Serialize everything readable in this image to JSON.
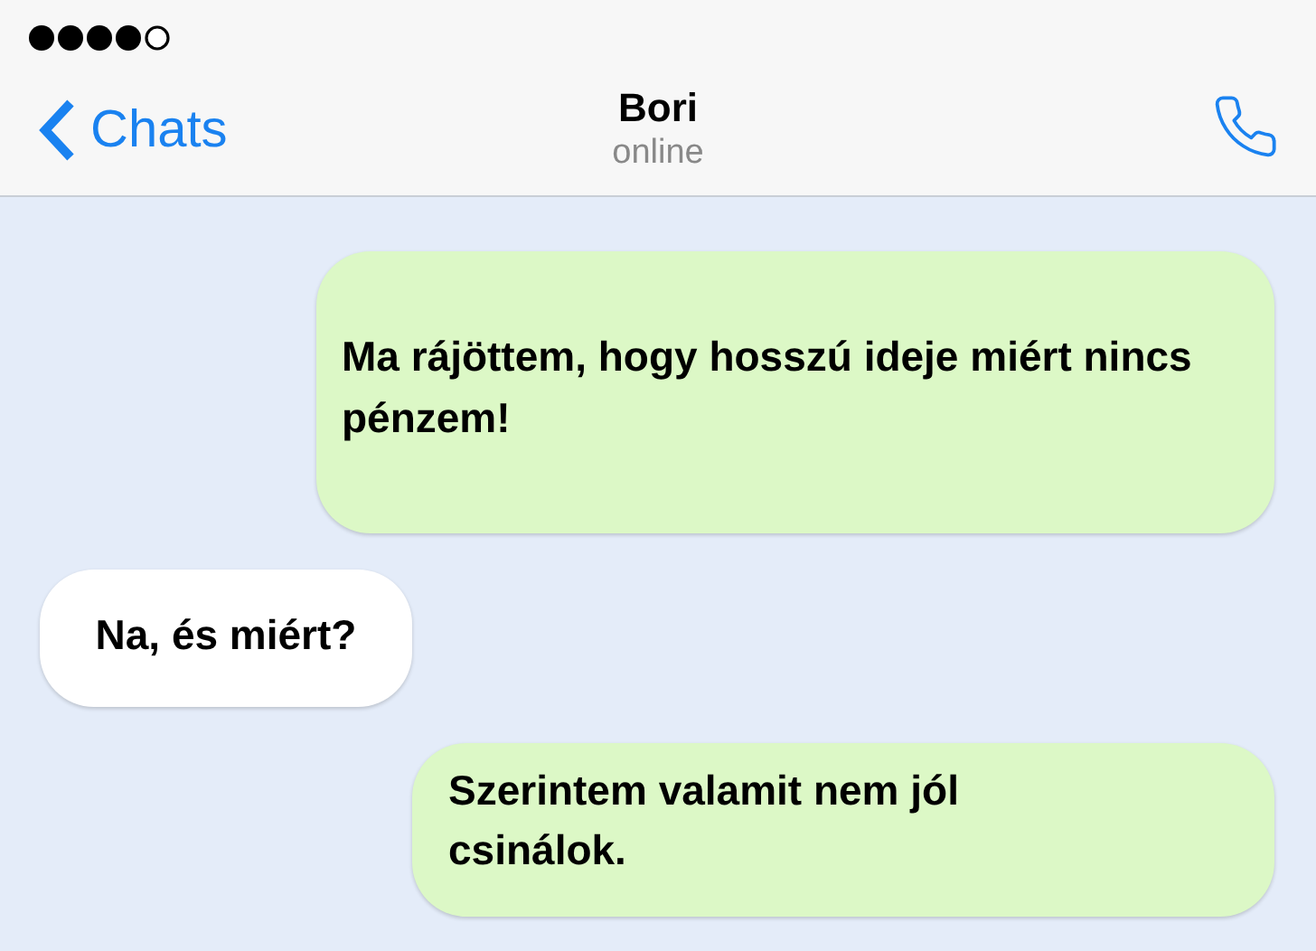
{
  "header": {
    "back_label": "Chats",
    "contact_name": "Bori",
    "status": "online"
  },
  "messages": [
    {
      "kind": "sent",
      "text": "Ma rájöttem, hogy hosszú ideje miért nincs pénzem!"
    },
    {
      "kind": "received",
      "text": "Na, és miért?"
    },
    {
      "kind": "sent",
      "text": "Szerintem valamit nem jól csinálok."
    }
  ]
}
